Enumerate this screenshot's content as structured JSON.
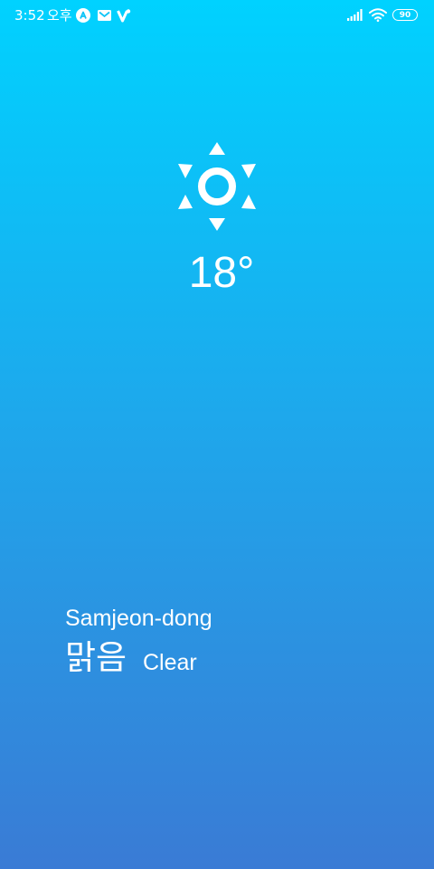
{
  "status_bar": {
    "time": "3:52",
    "ampm": "오후",
    "battery": "90",
    "icons": [
      "app-a-icon",
      "gmail-icon",
      "v-app-icon",
      "signal-icon",
      "wifi-icon",
      "battery-icon"
    ]
  },
  "weather": {
    "icon": "sun-icon",
    "temperature": "18°",
    "location": "Samjeon-dong",
    "condition_ko": "맑음",
    "condition_en": "Clear"
  },
  "colors": {
    "gradient_top": "#00d2ff",
    "gradient_bottom": "#3a7bd5",
    "text": "#ffffff"
  }
}
